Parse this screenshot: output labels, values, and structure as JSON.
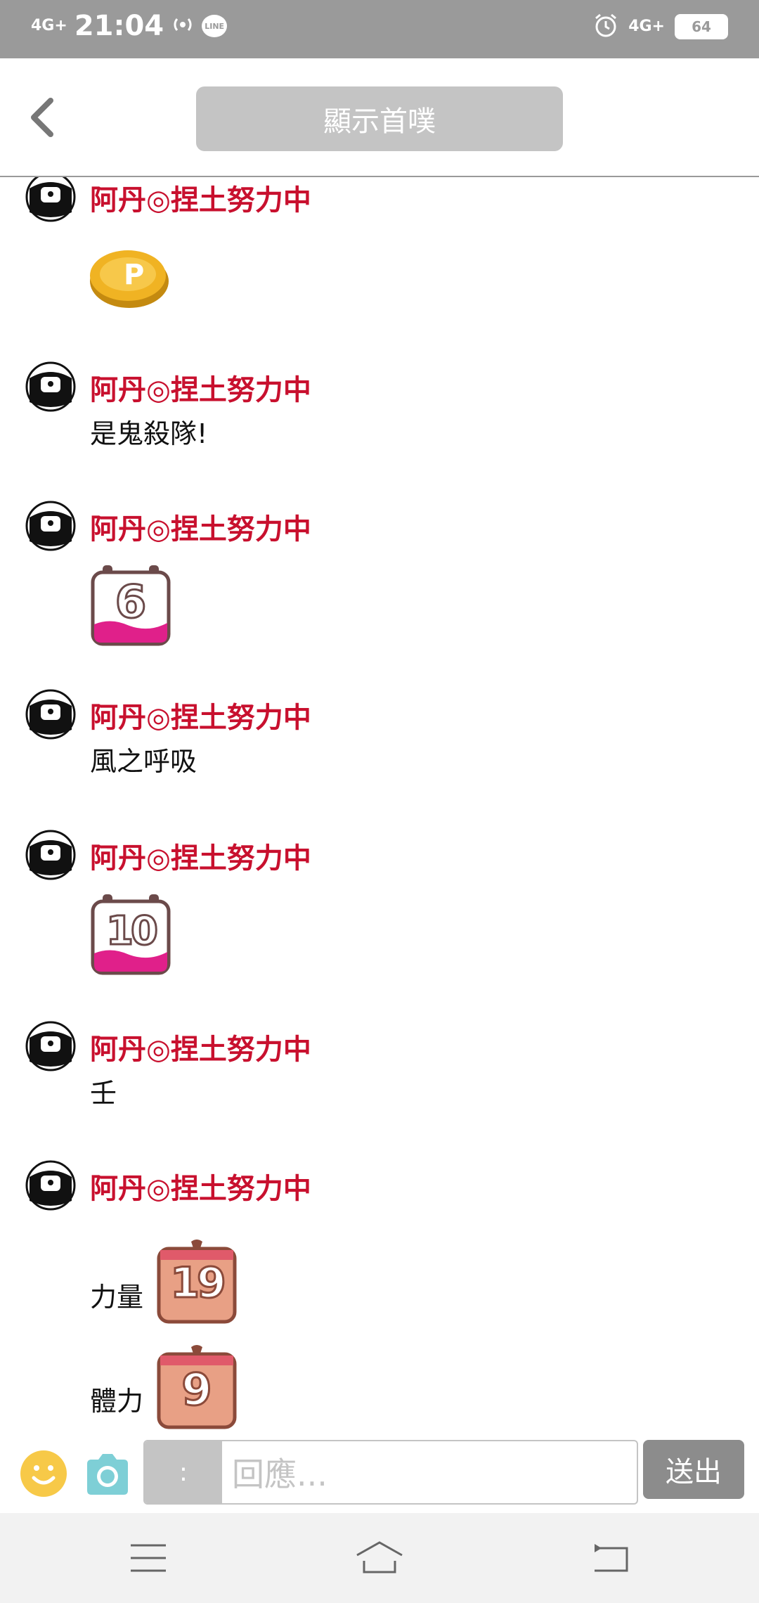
{
  "status_bar": {
    "network_left": "4G+",
    "time": "21:04",
    "line_badge": "LINE",
    "network_right": "4G+",
    "battery": "64"
  },
  "header": {
    "show_first_label": "顯示首噗"
  },
  "feed": {
    "messages": [
      {
        "author": "阿丹◎捏土努力中",
        "text": "",
        "sticker": "p-coin"
      },
      {
        "author": "阿丹◎捏土努力中",
        "text": "是鬼殺隊!",
        "sticker": ""
      },
      {
        "author": "阿丹◎捏土努力中",
        "text": "",
        "sticker": "6"
      },
      {
        "author": "阿丹◎捏土努力中",
        "text": "風之呼吸",
        "sticker": ""
      },
      {
        "author": "阿丹◎捏土努力中",
        "text": "",
        "sticker": "10"
      },
      {
        "author": "阿丹◎捏土努力中",
        "text": "壬",
        "sticker": ""
      },
      {
        "author": "阿丹◎捏土努力中",
        "lines": [
          {
            "text": "力量",
            "dice": "19"
          },
          {
            "text": "體力",
            "dice": "9"
          }
        ]
      }
    ]
  },
  "input_bar": {
    "qualifier": ":",
    "placeholder": "回應...",
    "send_label": "送出"
  },
  "colors": {
    "author": "#c8102e",
    "status_bar": "#9a9a9a",
    "button_gray": "#c4c4c4",
    "send_gray": "#8c8c8c"
  }
}
